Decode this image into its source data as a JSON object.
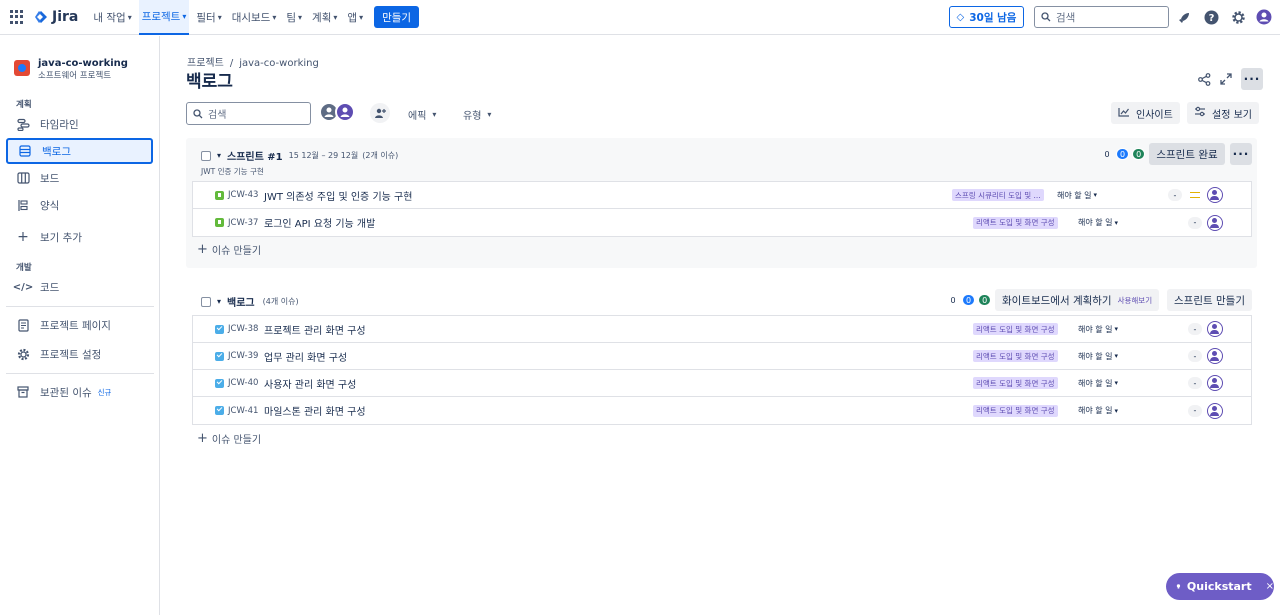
{
  "topnav": {
    "product": "Jira",
    "items": [
      {
        "label": "내 작업",
        "active": false
      },
      {
        "label": "프로젝트",
        "active": true
      },
      {
        "label": "필터",
        "active": false
      },
      {
        "label": "대시보드",
        "active": false
      },
      {
        "label": "팀",
        "active": false
      },
      {
        "label": "계획",
        "active": false
      },
      {
        "label": "앱",
        "active": false
      }
    ],
    "create_label": "만들기",
    "trial_label": "30일 남음",
    "search_placeholder": "검색"
  },
  "sidebar": {
    "project_name": "java-co-working",
    "project_type": "소프트웨어 프로젝트",
    "planning_title": "계획",
    "dev_title": "개발",
    "items": {
      "timeline": "타임라인",
      "backlog": "백로그",
      "board": "보드",
      "forms": "양식",
      "add_view": "보기 추가",
      "code": "코드",
      "project_pages": "프로젝트 페이지",
      "project_settings": "프로젝트 설정",
      "archived": "보관된 이슈",
      "archived_badge": "신규"
    }
  },
  "main": {
    "breadcrumb": [
      "프로젝트",
      "java-co-working"
    ],
    "breadcrumb_sep": "/",
    "title": "백로그",
    "search_placeholder": "검색",
    "filters": {
      "epic": "에픽",
      "type": "유형"
    },
    "insights_label": "인사이트",
    "view_settings_label": "설정 보기",
    "create_issue_label": "이슈 만들기"
  },
  "sprint": {
    "name": "스프린트 #1",
    "dates": "15 12월 – 29 12월",
    "issue_count": "(2개 이슈)",
    "goal": "JWT 인증 기능 구현",
    "counts": {
      "todo": "0",
      "in_progress": "0",
      "done": "0"
    },
    "complete_label": "스프린트 완료",
    "issues": [
      {
        "key": "JCW-43",
        "type": "story",
        "summary": "JWT 의존성 주입 및 인증 기능 구현",
        "epic": "스프링 시큐리티 도입 및 ...",
        "status": "해야 할 일",
        "estimate": "-",
        "priority": "medium"
      },
      {
        "key": "JCW-37",
        "type": "story",
        "summary": "로그인 API 요청 기능 개발",
        "epic": "리액트 도입 및 화면 구성",
        "status": "해야 할 일",
        "estimate": "-",
        "priority": ""
      }
    ]
  },
  "backlog": {
    "name": "백로그",
    "issue_count": "(4개 이슈)",
    "counts": {
      "todo": "0",
      "in_progress": "0",
      "done": "0"
    },
    "whiteboard_label": "화이트보드에서 계획하기",
    "whiteboard_badge": "사용해보기",
    "create_sprint_label": "스프린트 만들기",
    "issues": [
      {
        "key": "JCW-38",
        "type": "task",
        "summary": "프로젝트 관리 화면 구성",
        "epic": "리액트 도입 및 화면 구성",
        "status": "해야 할 일",
        "estimate": "-"
      },
      {
        "key": "JCW-39",
        "type": "task",
        "summary": "업무 관리 화면 구성",
        "epic": "리액트 도입 및 화면 구성",
        "status": "해야 할 일",
        "estimate": "-"
      },
      {
        "key": "JCW-40",
        "type": "task",
        "summary": "사용자 관리 화면 구성",
        "epic": "리액트 도입 및 화면 구성",
        "status": "해야 할 일",
        "estimate": "-"
      },
      {
        "key": "JCW-41",
        "type": "task",
        "summary": "마일스톤 관리 화면 구성",
        "epic": "리액트 도입 및 화면 구성",
        "status": "해야 할 일",
        "estimate": "-"
      }
    ]
  },
  "quickstart": {
    "label": "Quickstart",
    "close": "×"
  },
  "colors": {
    "accent": "#0c66e4",
    "epic_bg": "#dfd8fd",
    "epic_text": "#5e4db2",
    "quickstart": "#6e5dc6"
  }
}
